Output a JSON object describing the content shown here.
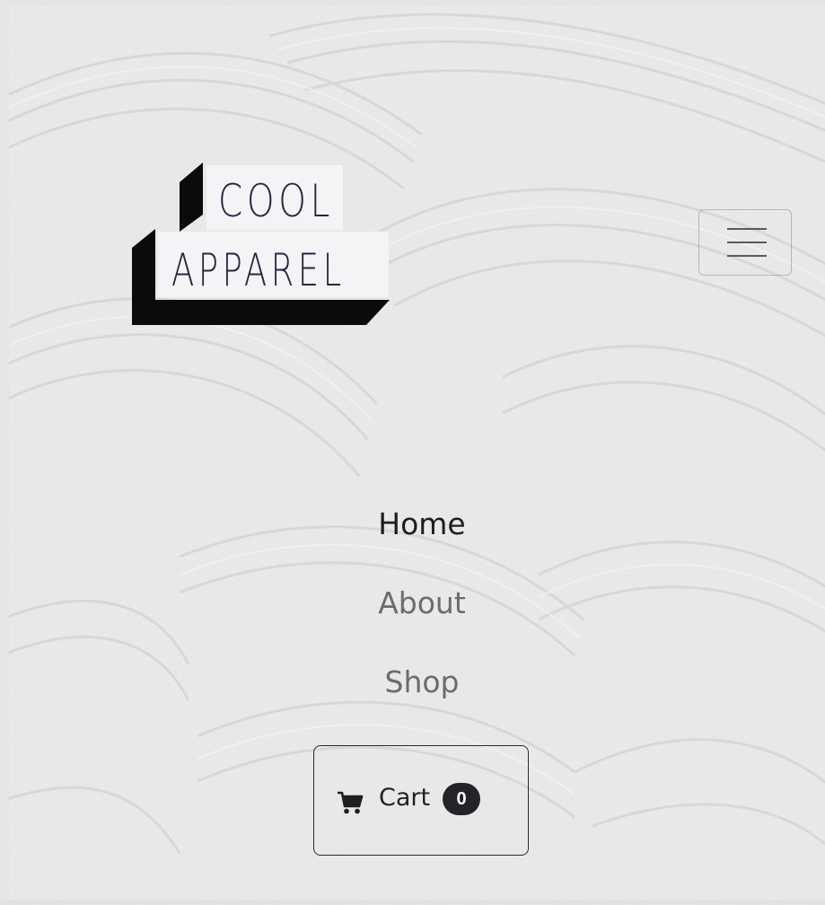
{
  "brand": {
    "logo_line1": "COOL",
    "logo_line2": "APPAREL"
  },
  "header": {
    "menu_icon": "hamburger-menu-icon"
  },
  "nav": {
    "items": [
      {
        "label": "Home",
        "active": true
      },
      {
        "label": "About",
        "active": false
      },
      {
        "label": "Shop",
        "active": false
      }
    ]
  },
  "cart": {
    "icon": "shopping-cart-icon",
    "label": "Cart",
    "count": "0"
  },
  "colors": {
    "background": "#ececec",
    "brand_text": "#2b2440",
    "logo_block": "#0b0b0b",
    "active_link": "#1e1e1e",
    "inactive_link": "#6c6c6c",
    "badge": "#23232b"
  }
}
